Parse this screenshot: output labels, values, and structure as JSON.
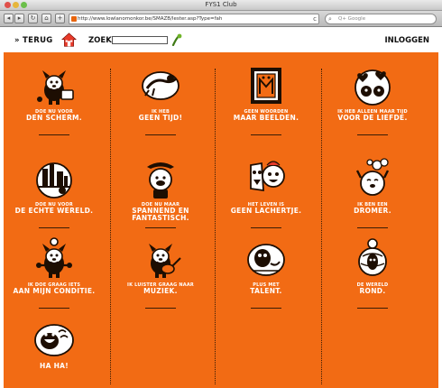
{
  "browser": {
    "window_title": "FYS1 Club",
    "url": "http://www.lowlanomonkor.be/SMAZB/lester.asp?Type=fah",
    "search_placeholder": "Q+ Google",
    "back_glyph": "◂",
    "forward_glyph": "▸",
    "reload_glyph": "↻",
    "home_glyph": "⌂",
    "add_glyph": "+"
  },
  "header": {
    "back_label": "» TERUG",
    "search_label": "ZOEK",
    "login_label": "INLOGGEN"
  },
  "colors": {
    "orange": "#f26b14",
    "ink": "#1d0e02",
    "white": "#ffffff"
  },
  "cards": [
    {
      "small": "DOE NU VOOR",
      "big": "DEN SCHERM.",
      "icon": "dog-with-tv-icon"
    },
    {
      "small": "IK HEB",
      "big": "GEEN TIJD!",
      "icon": "running-dog-icon"
    },
    {
      "small": "GEEN WOORDEN",
      "big": "MAAR BEELDEN.",
      "icon": "framed-picture-icon"
    },
    {
      "small": "IK HEB ALLEEN MAAR TIJD",
      "big": "VOOR DE LIEFDE.",
      "icon": "hearts-couple-icon"
    },
    {
      "small": "DOE NU VOOR",
      "big": "DE ECHTE WERELD.",
      "icon": "city-globe-icon"
    },
    {
      "small": "DOE NU MAAR",
      "big": "SPANNEND EN FANTASTISCH.",
      "icon": "cowboy-dog-icon"
    },
    {
      "small": "HET LEVEN IS",
      "big": "GEEN LACHERTJE.",
      "icon": "laughing-faces-icon"
    },
    {
      "small": "IK BEN EEN",
      "big": "DROMER.",
      "icon": "dreamer-dog-icon"
    },
    {
      "small": "IK DOE GRAAG IETS",
      "big": "AAN MIJN CONDITIE.",
      "icon": "fitness-dog-icon"
    },
    {
      "small": "IK LUISTER GRAAG NAAR",
      "big": "MUZIEK.",
      "icon": "guitar-dog-icon"
    },
    {
      "small": "PLUS MET",
      "big": "TALENT.",
      "icon": "talent-dog-icon"
    },
    {
      "small": "DE WERELD",
      "big": "ROND.",
      "icon": "world-traveler-icon"
    },
    {
      "small": "",
      "big": "HA HA!",
      "icon": "laughing-dog-icon"
    }
  ]
}
